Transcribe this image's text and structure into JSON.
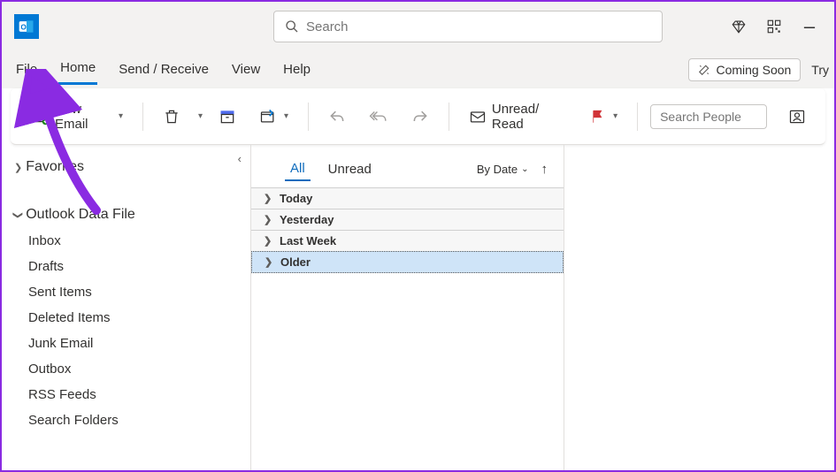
{
  "titlebar": {
    "search_placeholder": "Search"
  },
  "tabs": {
    "file": "File",
    "home": "Home",
    "send_receive": "Send / Receive",
    "view": "View",
    "help": "Help",
    "coming_soon": "Coming Soon",
    "try": "Try"
  },
  "ribbon": {
    "new_email": "New Email",
    "unread_read": "Unread/ Read",
    "search_people_placeholder": "Search People"
  },
  "nav": {
    "favorites": "Favorites",
    "data_file": "Outlook Data File",
    "folders": {
      "inbox": "Inbox",
      "drafts": "Drafts",
      "sent": "Sent Items",
      "deleted": "Deleted Items",
      "junk": "Junk Email",
      "outbox": "Outbox",
      "rss": "RSS Feeds",
      "search": "Search Folders"
    }
  },
  "msglist": {
    "filter_all": "All",
    "filter_unread": "Unread",
    "sort_label": "By Date",
    "groups": {
      "today": "Today",
      "yesterday": "Yesterday",
      "last_week": "Last Week",
      "older": "Older"
    }
  }
}
